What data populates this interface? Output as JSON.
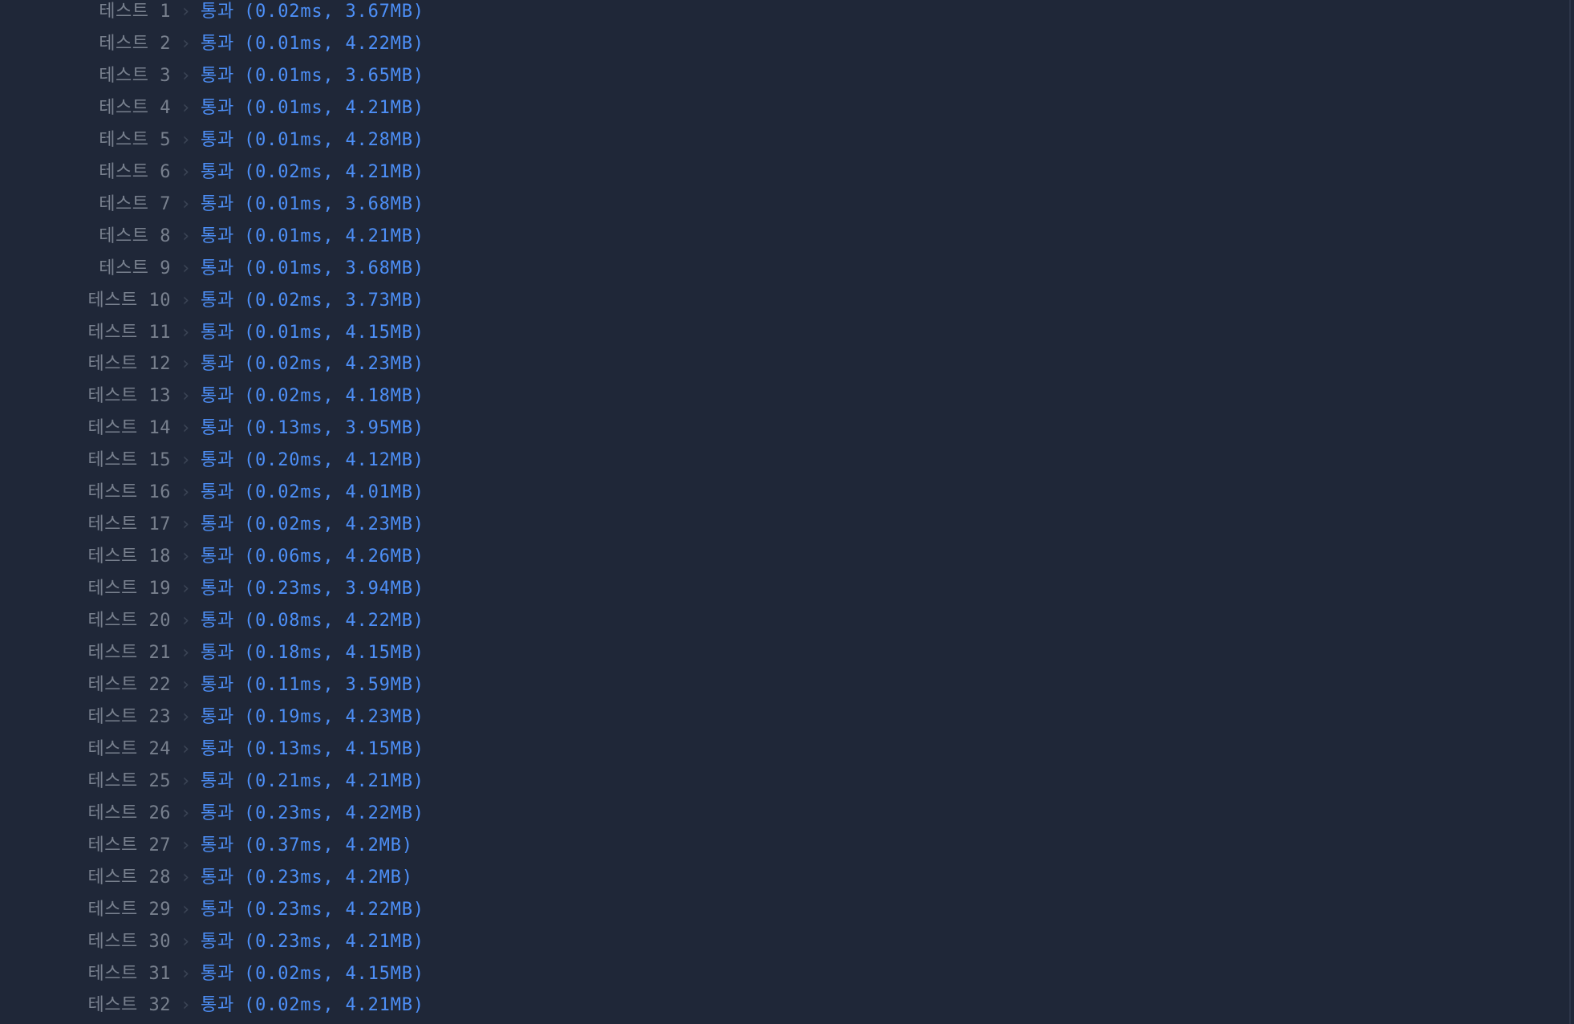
{
  "tests": [
    {
      "label": "테스트 1",
      "status": "통과",
      "detail": "(0.02ms, 3.67MB)"
    },
    {
      "label": "테스트 2",
      "status": "통과",
      "detail": "(0.01ms, 4.22MB)"
    },
    {
      "label": "테스트 3",
      "status": "통과",
      "detail": "(0.01ms, 3.65MB)"
    },
    {
      "label": "테스트 4",
      "status": "통과",
      "detail": "(0.01ms, 4.21MB)"
    },
    {
      "label": "테스트 5",
      "status": "통과",
      "detail": "(0.01ms, 4.28MB)"
    },
    {
      "label": "테스트 6",
      "status": "통과",
      "detail": "(0.02ms, 4.21MB)"
    },
    {
      "label": "테스트 7",
      "status": "통과",
      "detail": "(0.01ms, 3.68MB)"
    },
    {
      "label": "테스트 8",
      "status": "통과",
      "detail": "(0.01ms, 4.21MB)"
    },
    {
      "label": "테스트 9",
      "status": "통과",
      "detail": "(0.01ms, 3.68MB)"
    },
    {
      "label": "테스트 10",
      "status": "통과",
      "detail": "(0.02ms, 3.73MB)"
    },
    {
      "label": "테스트 11",
      "status": "통과",
      "detail": "(0.01ms, 4.15MB)"
    },
    {
      "label": "테스트 12",
      "status": "통과",
      "detail": "(0.02ms, 4.23MB)"
    },
    {
      "label": "테스트 13",
      "status": "통과",
      "detail": "(0.02ms, 4.18MB)"
    },
    {
      "label": "테스트 14",
      "status": "통과",
      "detail": "(0.13ms, 3.95MB)"
    },
    {
      "label": "테스트 15",
      "status": "통과",
      "detail": "(0.20ms, 4.12MB)"
    },
    {
      "label": "테스트 16",
      "status": "통과",
      "detail": "(0.02ms, 4.01MB)"
    },
    {
      "label": "테스트 17",
      "status": "통과",
      "detail": "(0.02ms, 4.23MB)"
    },
    {
      "label": "테스트 18",
      "status": "통과",
      "detail": "(0.06ms, 4.26MB)"
    },
    {
      "label": "테스트 19",
      "status": "통과",
      "detail": "(0.23ms, 3.94MB)"
    },
    {
      "label": "테스트 20",
      "status": "통과",
      "detail": "(0.08ms, 4.22MB)"
    },
    {
      "label": "테스트 21",
      "status": "통과",
      "detail": "(0.18ms, 4.15MB)"
    },
    {
      "label": "테스트 22",
      "status": "통과",
      "detail": "(0.11ms, 3.59MB)"
    },
    {
      "label": "테스트 23",
      "status": "통과",
      "detail": "(0.19ms, 4.23MB)"
    },
    {
      "label": "테스트 24",
      "status": "통과",
      "detail": "(0.13ms, 4.15MB)"
    },
    {
      "label": "테스트 25",
      "status": "통과",
      "detail": "(0.21ms, 4.21MB)"
    },
    {
      "label": "테스트 26",
      "status": "통과",
      "detail": "(0.23ms, 4.22MB)"
    },
    {
      "label": "테스트 27",
      "status": "통과",
      "detail": "(0.37ms, 4.2MB)"
    },
    {
      "label": "테스트 28",
      "status": "통과",
      "detail": "(0.23ms, 4.2MB)"
    },
    {
      "label": "테스트 29",
      "status": "통과",
      "detail": "(0.23ms, 4.22MB)"
    },
    {
      "label": "테스트 30",
      "status": "통과",
      "detail": "(0.23ms, 4.21MB)"
    },
    {
      "label": "테스트 31",
      "status": "통과",
      "detail": "(0.02ms, 4.15MB)"
    },
    {
      "label": "테스트 32",
      "status": "통과",
      "detail": "(0.02ms, 4.21MB)"
    }
  ],
  "separator_icon": "chevron-right-icon",
  "colors": {
    "background": "#1f2738",
    "label": "#78808e",
    "separator": "#3b4455",
    "pass": "#4d8ff7"
  }
}
